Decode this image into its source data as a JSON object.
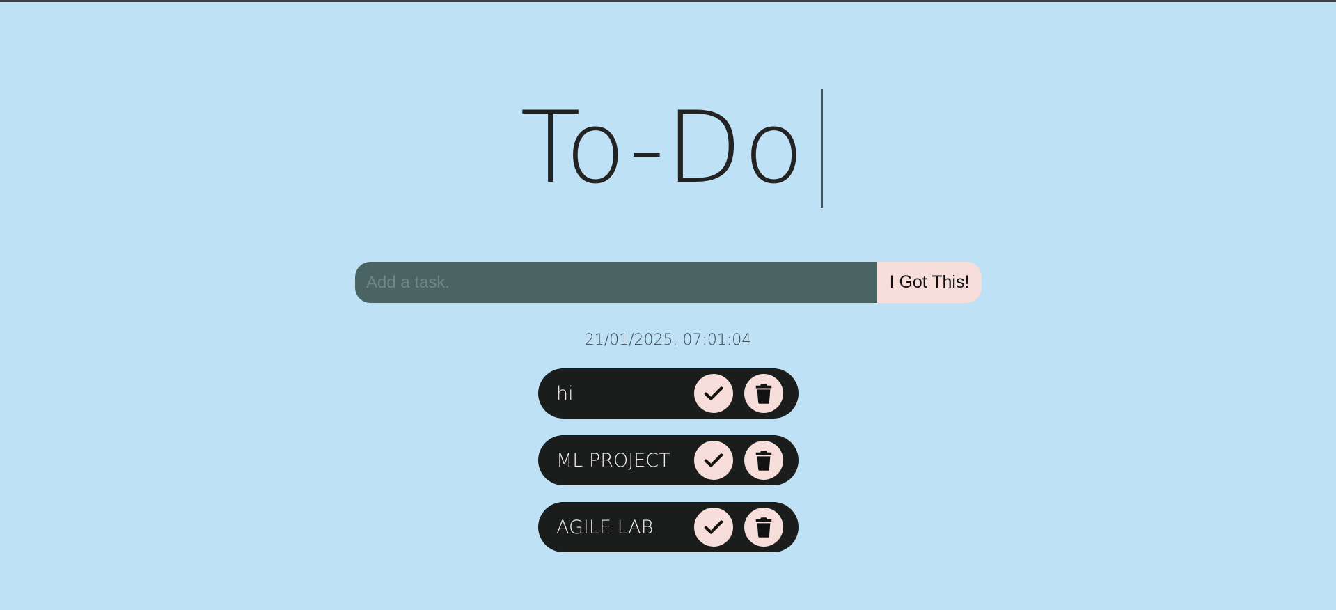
{
  "header": {
    "title": "To-Do"
  },
  "form": {
    "placeholder": "Add a task.",
    "value": "",
    "submit_label": "I Got This!"
  },
  "timestamp": "21/01/2025, 07:01:04",
  "tasks": [
    {
      "text": "hi",
      "complete_icon": "check-icon",
      "delete_icon": "trash-icon"
    },
    {
      "text": "ML PROJECT",
      "complete_icon": "check-icon",
      "delete_icon": "trash-icon"
    },
    {
      "text": "AGILE LAB",
      "complete_icon": "check-icon",
      "delete_icon": "trash-icon"
    }
  ],
  "colors": {
    "background": "#bfe1f6",
    "input_bg": "#4a6363",
    "button_bg": "#f8dedb",
    "task_bg": "#1b1c1c"
  }
}
